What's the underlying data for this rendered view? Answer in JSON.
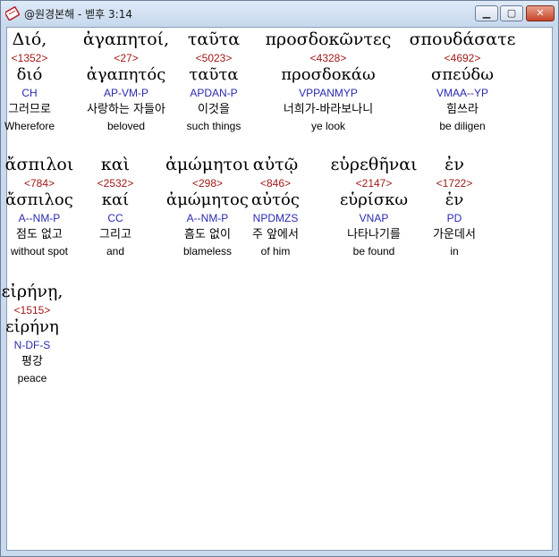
{
  "window": {
    "title": "@원경본해 - 벧후 3:14",
    "controls": {
      "minimize": "▁",
      "maximize": "▢",
      "close": "✕"
    }
  },
  "rows": [
    [
      {
        "greek": "Διό,",
        "strong": "<1352>",
        "lemma": "διό",
        "parse": "CH",
        "korean": "그러므로",
        "english": "Wherefore"
      },
      {
        "greek": "ἀγαπητοί,",
        "strong": "<27>",
        "lemma": "ἀγαπητός",
        "parse": "AP-VM-P",
        "korean": "사랑하는 자들아",
        "english": "beloved"
      },
      {
        "greek": "ταῦτα",
        "strong": "<5023>",
        "lemma": "ταῦτα",
        "parse": "APDAN-P",
        "korean": "이것을",
        "english": "such things"
      },
      {
        "greek": "προσδοκῶντες",
        "strong": "<4328>",
        "lemma": "προσδοκάω",
        "parse": "VPPANMYP",
        "korean": "너희가-바라보나니",
        "english": "ye look"
      },
      {
        "greek": "σπουδάσατε",
        "strong": "<4692>",
        "lemma": "σπεύδω",
        "parse": "VMAA--YP",
        "korean": "힘쓰라",
        "english": "be diligen"
      }
    ],
    [
      {
        "greek": "ἄσπιλοι",
        "strong": "<784>",
        "lemma": "ἄσπιλος",
        "parse": "A--NM-P",
        "korean": "점도 없고",
        "english": "without spot"
      },
      {
        "greek": "καὶ",
        "strong": "<2532>",
        "lemma": "καί",
        "parse": "CC",
        "korean": "그리고",
        "english": "and"
      },
      {
        "greek": "ἀμώμητοι",
        "strong": "<298>",
        "lemma": "ἀμώμητος",
        "parse": "A--NM-P",
        "korean": "흠도 없이",
        "english": "blameless"
      },
      {
        "greek": "αὐτῷ",
        "strong": "<846>",
        "lemma": "αὐτός",
        "parse": "NPDMZS",
        "korean": "주 앞에서",
        "english": "of him"
      },
      {
        "greek": "εὑρεθῆναι",
        "strong": "<2147>",
        "lemma": "εὑρίσκω",
        "parse": "VNAP",
        "korean": "나타나기를",
        "english": "be found"
      },
      {
        "greek": "ἐν",
        "strong": "<1722>",
        "lemma": "ἐν",
        "parse": "PD",
        "korean": "가운데서",
        "english": "in"
      }
    ],
    [
      {
        "greek": "εἰρήνῃ,",
        "strong": "<1515>",
        "lemma": "εἰρήνη",
        "parse": "N-DF-S",
        "korean": "평강",
        "english": "peace"
      }
    ]
  ]
}
